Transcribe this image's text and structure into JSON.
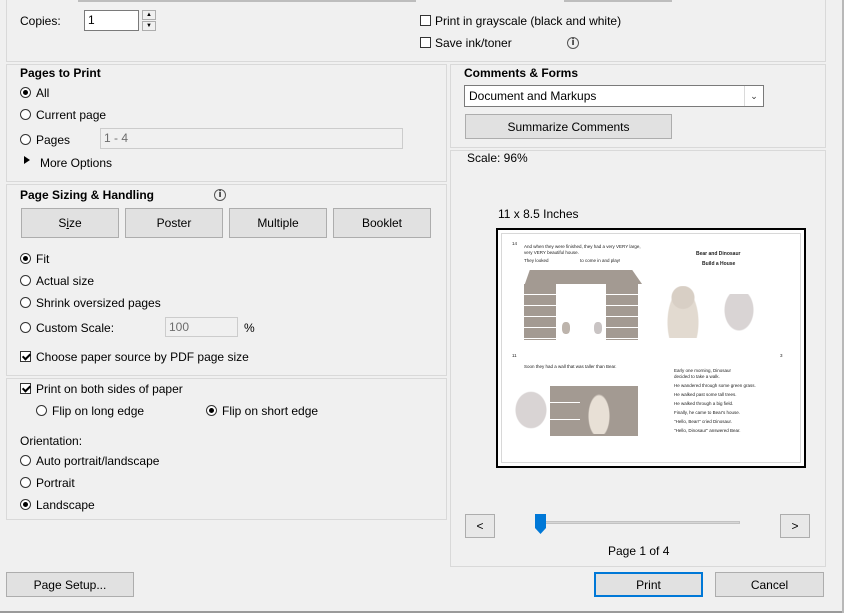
{
  "copies": {
    "label": "Copies:",
    "value": "1"
  },
  "grayscale": {
    "label": "Print in grayscale (black and white)",
    "checked": false
  },
  "save_ink": {
    "label": "Save ink/toner",
    "checked": false
  },
  "pages_to_print": {
    "title": "Pages to Print",
    "all": "All",
    "current": "Current page",
    "pages": "Pages",
    "pages_range": "1 - 4",
    "more_options": "More Options",
    "selected": "All"
  },
  "sizing": {
    "title": "Page Sizing & Handling",
    "buttons": [
      "Size",
      "Poster",
      "Multiple",
      "Booklet"
    ],
    "fit": "Fit",
    "actual": "Actual size",
    "shrink": "Shrink oversized pages",
    "custom": "Custom Scale:",
    "custom_value": "100",
    "percent": "%",
    "paper_source": "Choose paper source by PDF page size",
    "selected": "Fit"
  },
  "duplex": {
    "label": "Print on both sides of paper",
    "long_edge": "Flip on long edge",
    "short_edge": "Flip on short edge",
    "selected": "Flip on short edge"
  },
  "orientation": {
    "title": "Orientation:",
    "auto": "Auto portrait/landscape",
    "portrait": "Portrait",
    "landscape": "Landscape",
    "selected": "Landscape"
  },
  "comments": {
    "title": "Comments & Forms",
    "dropdown": "Document and Markups",
    "summarize": "Summarize Comments"
  },
  "preview": {
    "scale": "Scale:  96%",
    "paper_size": "11 x 8.5 Inches",
    "page_indicator": "Page 1 of 4",
    "prev": "<",
    "next": ">",
    "slider_fraction": 0
  },
  "thumb": {
    "p1_num": "14",
    "p1_text": "And when they were finished, they had a very VERY large, very VERY beautiful house.",
    "p1_caption_left": "They looked",
    "p1_caption_right": "to come in and play!",
    "title_line1": "Bear and Dinosaur",
    "title_line2": "Build a House",
    "p2_num": "11",
    "p2_text": "Soon they had a wall that was taller than Bear.",
    "p3_num": "3",
    "p3_lines": [
      "Early one morning, Dinosaur decided to take a walk.",
      "He wandered through some green grass.",
      "He walked past some tall trees.",
      "He walked through a big field.",
      "Finally, he came to Bear's house.",
      "\"Hello, Bear!\" cried Dinosaur.",
      "\"Hello, Dinosaur\" answered Bear."
    ]
  },
  "footer": {
    "page_setup": "Page Setup...",
    "print": "Print",
    "cancel": "Cancel"
  }
}
